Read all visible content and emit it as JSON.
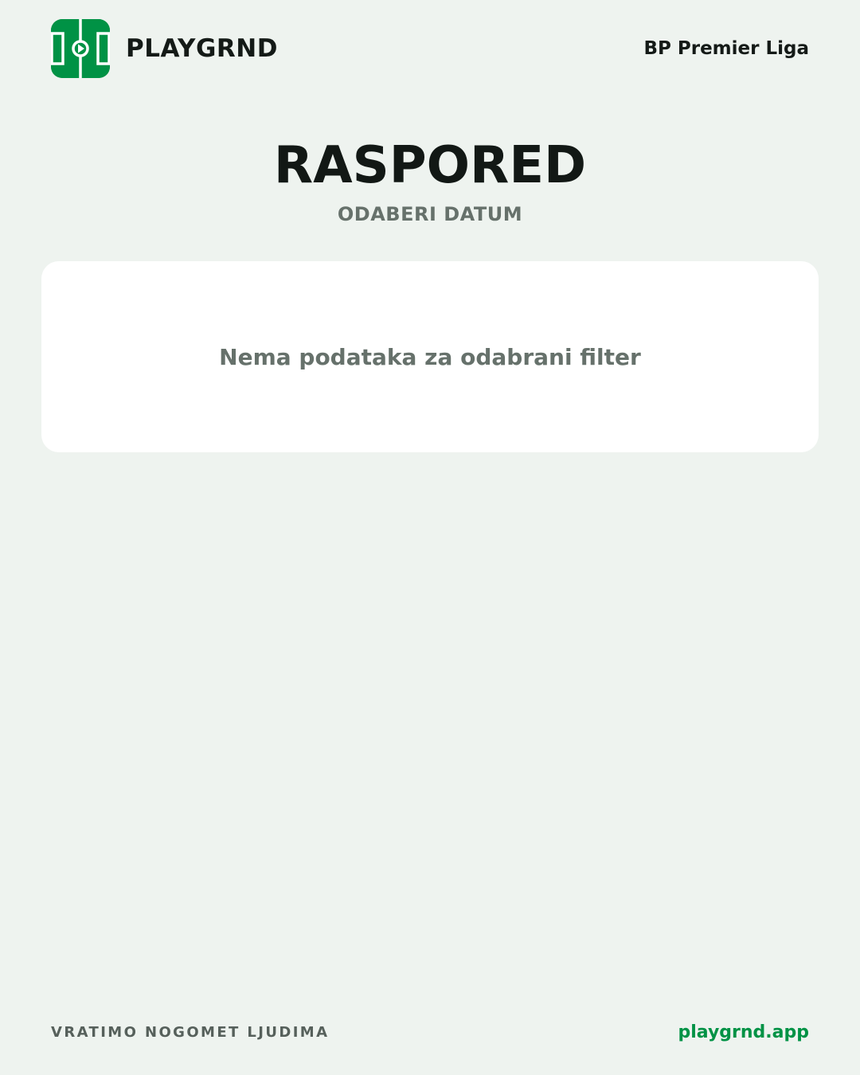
{
  "header": {
    "brand_name": "PLAYGRND",
    "logo_icon": "football-pitch-play-icon",
    "league_name": "BP Premier Liga"
  },
  "main": {
    "title": "RASPORED",
    "date_picker_label": "ODABERI DATUM",
    "empty_message": "Nema podataka za odabrani filter"
  },
  "footer": {
    "tagline": "VRATIMO NOGOMET LJUDIMA",
    "site_link": "playgrnd.app"
  },
  "colors": {
    "background": "#eef3ef",
    "brand_green": "#009245",
    "card": "#ffffff",
    "muted_text": "#66716b",
    "dark_text": "#121815"
  }
}
